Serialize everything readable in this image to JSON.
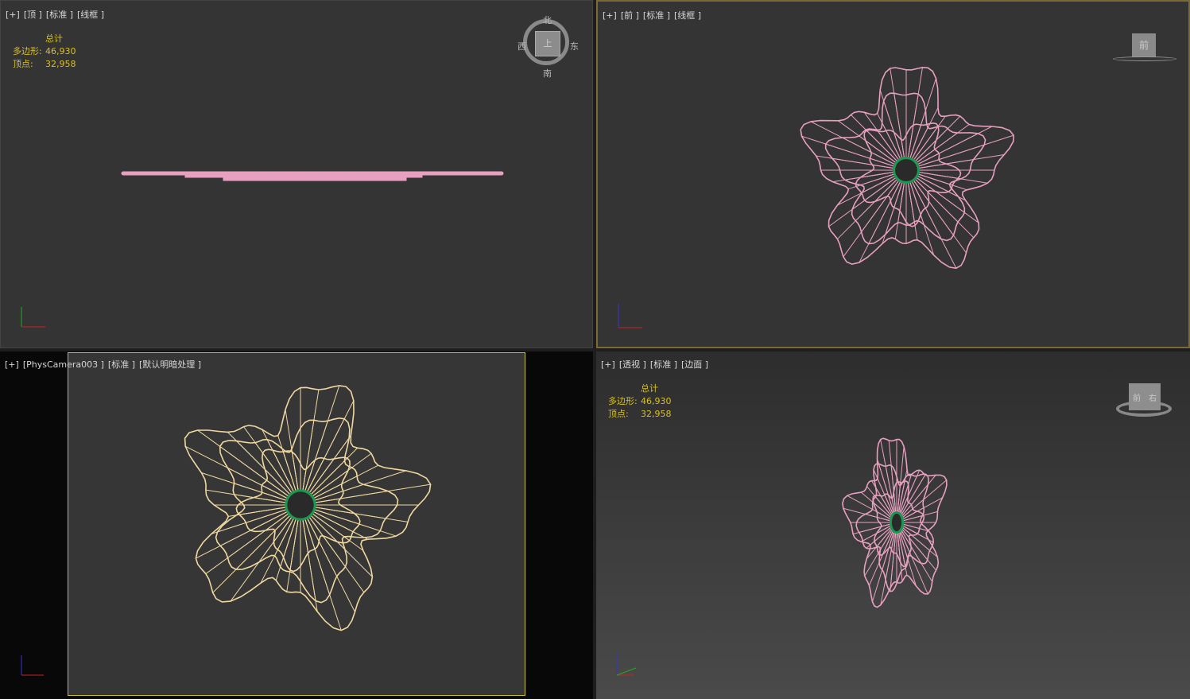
{
  "viewports": [
    {
      "name": "top",
      "labels": [
        "[+]",
        "[顶 ]",
        "[标准 ]",
        "[线框 ]"
      ],
      "wire_color": "#e8a0c0",
      "active": false,
      "stats": {
        "header": "总计",
        "polygons_label": "多边形:",
        "polygons": "46,930",
        "vertices_label": "顶点:",
        "vertices": "32,958"
      },
      "viewcube": {
        "face": "上",
        "north": "北",
        "south": "南",
        "east": "东",
        "west": "西"
      }
    },
    {
      "name": "front",
      "labels": [
        "[+]",
        "[前 ]",
        "[标准 ]",
        "[线框 ]"
      ],
      "wire_color": "#e8a0c0",
      "active": true,
      "viewcube": {
        "face": "前"
      }
    },
    {
      "name": "camera",
      "labels": [
        "[+]",
        "[PhysCamera003 ]",
        "[标准 ]",
        "[默认明暗处理 ]"
      ],
      "wire_color": "#f0d8a0",
      "active": false
    },
    {
      "name": "perspective",
      "labels": [
        "[+]",
        "[透视 ]",
        "[标准 ]",
        "[边面 ]"
      ],
      "wire_color": "#e8a0c0",
      "active": false,
      "stats": {
        "header": "总计",
        "polygons_label": "多边形:",
        "polygons": "46,930",
        "vertices_label": "顶点:",
        "vertices": "32,958"
      },
      "viewcube": {
        "face": "前",
        "side": "右"
      }
    }
  ],
  "colors": {
    "active_border": "#7d6a33",
    "stats_text": "#d8c020",
    "safe_frame": "#c8c020",
    "center_ring": "#1a9a50"
  }
}
